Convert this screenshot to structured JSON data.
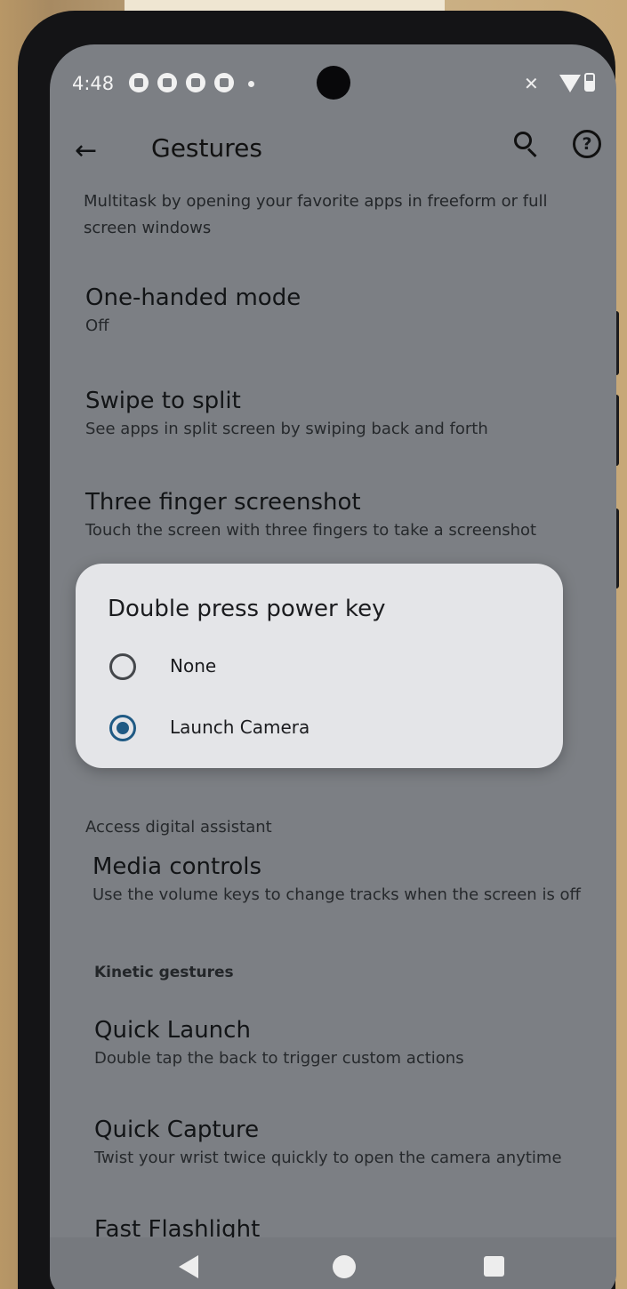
{
  "status_bar": {
    "time": "4:48"
  },
  "app_bar": {
    "title": "Gestures"
  },
  "settings": {
    "top_description": "Multitask by opening your favorite apps in freeform or full screen windows",
    "items": [
      {
        "title": "One-handed mode",
        "summary": "Off"
      },
      {
        "title": "Swipe to split",
        "summary": "See apps in split screen by swiping back and forth"
      },
      {
        "title": "Three finger screenshot",
        "summary": "Touch the screen with three fingers to take a screenshot"
      },
      {
        "title": "",
        "summary": "Access digital assistant"
      },
      {
        "title": "Media controls",
        "summary": "Use the volume keys to change tracks when the screen is off"
      }
    ],
    "section_kinetic": "Kinetic gestures",
    "kinetic_items": [
      {
        "title": "Quick Launch",
        "summary": "Double tap the back to trigger custom actions"
      },
      {
        "title": "Quick Capture",
        "summary": "Twist your wrist twice quickly to open the camera anytime"
      },
      {
        "title": "Fast Flashlight",
        "summary": ""
      }
    ]
  },
  "dialog": {
    "title": "Double press power key",
    "options": [
      {
        "label": "None",
        "selected": false
      },
      {
        "label": "Launch Camera",
        "selected": true
      }
    ]
  }
}
